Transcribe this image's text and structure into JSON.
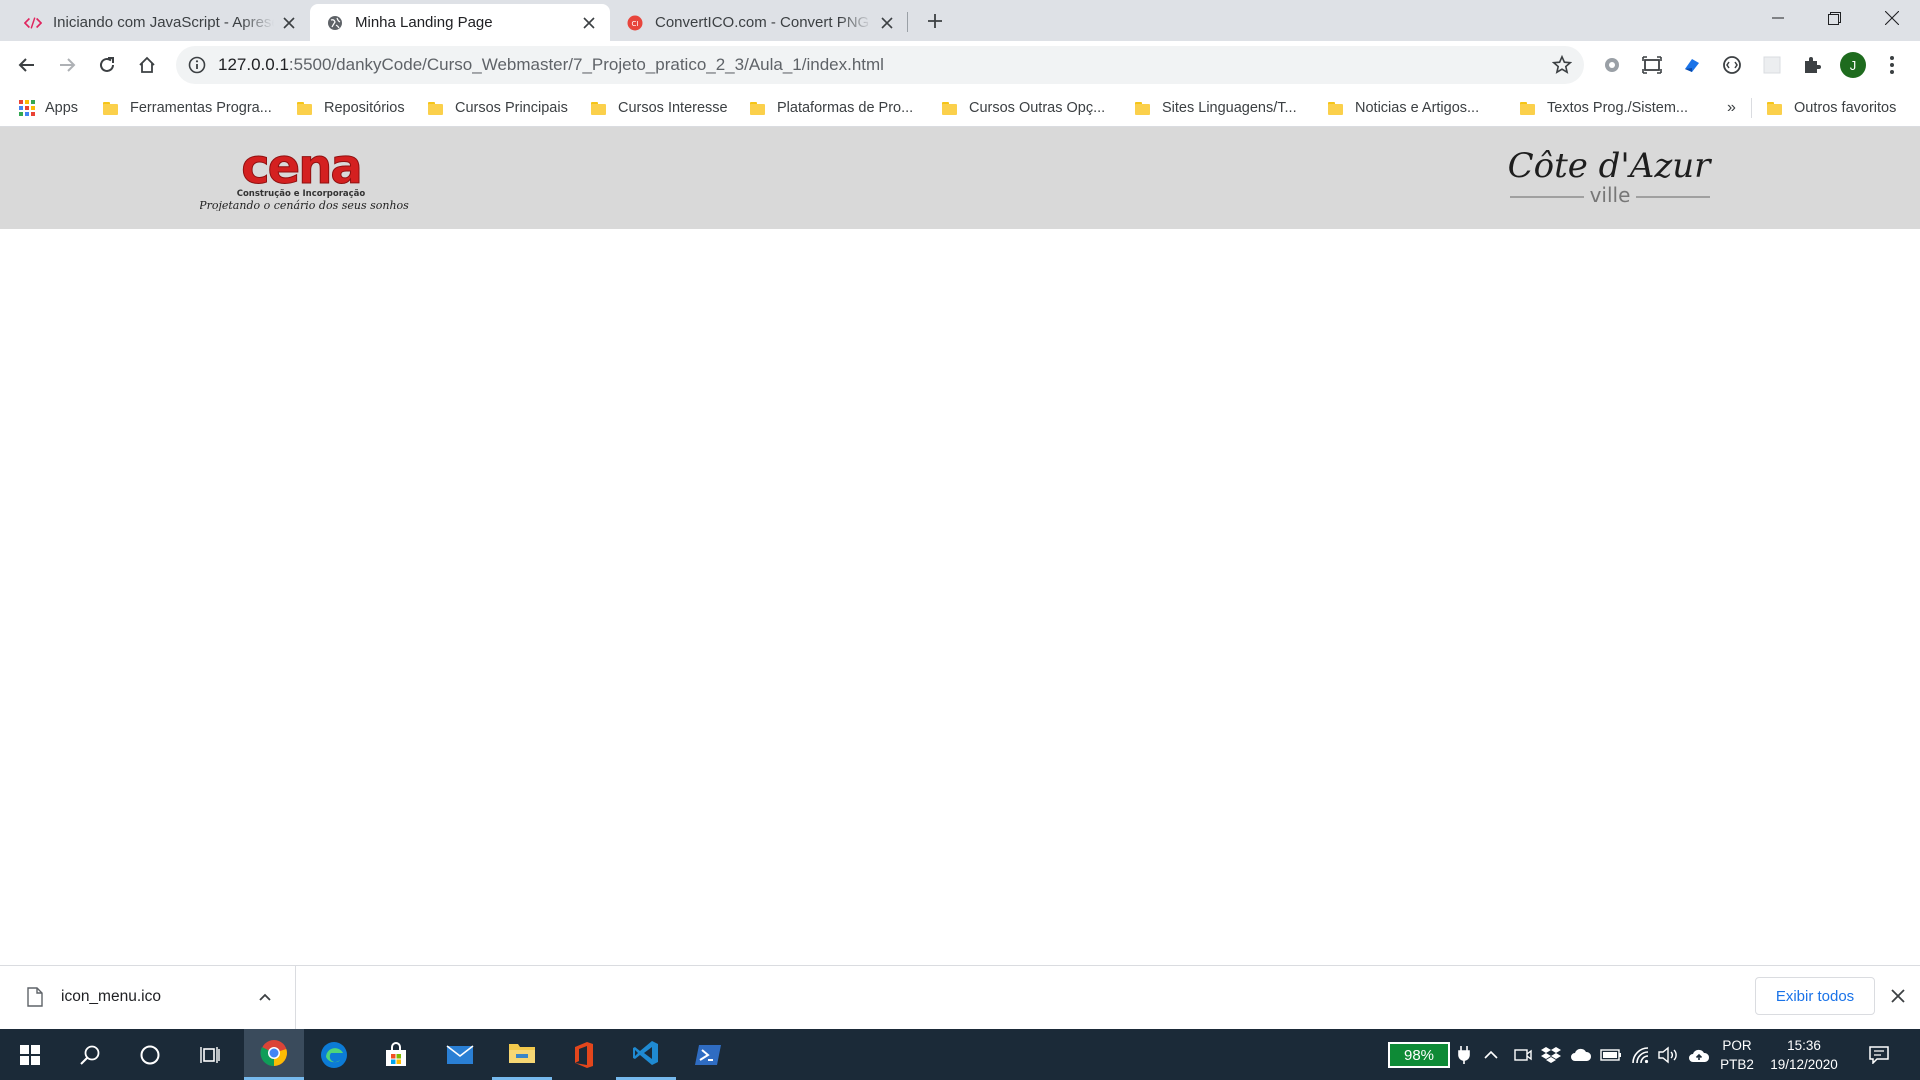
{
  "browser": {
    "tabs": [
      {
        "title": "Iniciando com JavaScript - Apresentação",
        "active": false
      },
      {
        "title": "Minha Landing Page",
        "active": true
      },
      {
        "title": "ConvertICO.com - Convert PNG to ICO",
        "active": false
      }
    ],
    "address_bar": {
      "host": "127.0.0.1",
      "path": ":5500/dankyCode/Curso_Webmaster/7_Projeto_pratico_2_3/Aula_1/index.html"
    },
    "profile_initial": "J",
    "bookmarks": [
      "Apps",
      "Ferramentas Progra...",
      "Repositórios",
      "Cursos Principais",
      "Cursos Interesse",
      "Plataformas de Pro...",
      "Cursos Outras Opç...",
      "Sites Linguagens/T...",
      "Noticias e Artigos...",
      "Textos Prog./Sistem..."
    ],
    "bookmarks_overflow": "»",
    "other_bookmarks": "Outros favoritos"
  },
  "page": {
    "logo_left": {
      "name": "cena",
      "subtitle": "Construção e Incorporação",
      "tagline": "Projetando o cenário dos seus sonhos"
    },
    "logo_right": {
      "name": "Côte d'Azur",
      "subtitle": "ville"
    }
  },
  "downloads": {
    "file_name": "icon_menu.ico",
    "show_all": "Exibir todos"
  },
  "taskbar": {
    "battery": "98%",
    "language": "POR",
    "layout": "PTB2",
    "time": "15:36",
    "date": "19/12/2020"
  },
  "colors": {
    "cena_red": "#d42020",
    "header_gray": "#d9d9d9",
    "taskbar": "#1b2a38",
    "link_blue": "#1a73e8"
  }
}
